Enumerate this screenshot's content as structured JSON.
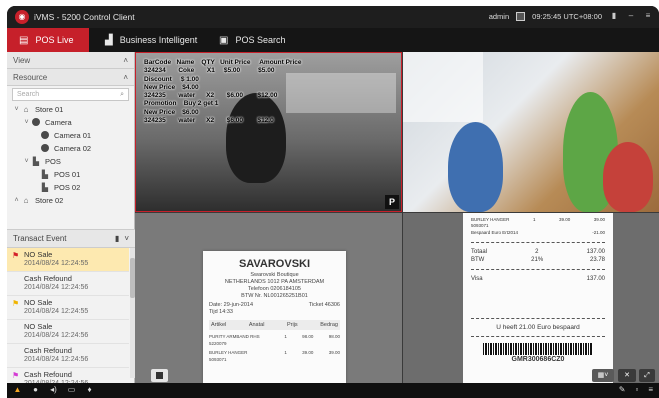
{
  "app": {
    "title": "iVMS - 5200 Control Client",
    "user": "admin",
    "clock": "09:25:45 UTC+08:00"
  },
  "nav": {
    "tabs": [
      {
        "label": "POS Live",
        "active": true
      },
      {
        "label": "Business Intelligent"
      },
      {
        "label": "POS Search"
      }
    ]
  },
  "sidebar": {
    "view_label": "View",
    "resource_label": "Resource",
    "search_placeholder": "Search",
    "tree": [
      {
        "label": "Store 01",
        "level": 0
      },
      {
        "label": "Camera",
        "level": 1
      },
      {
        "label": "Camera 01",
        "level": 2
      },
      {
        "label": "Camera 02",
        "level": 2
      },
      {
        "label": "POS",
        "level": 1
      },
      {
        "label": "POS 01",
        "level": 2
      },
      {
        "label": "POS 02",
        "level": 2
      },
      {
        "label": "Store 02",
        "level": 0
      }
    ]
  },
  "events": {
    "header": "Transact Event",
    "items": [
      {
        "name": "NO Sale",
        "time": "2014/08/24 12:24:55",
        "flag": "#d4202a",
        "selected": true
      },
      {
        "name": "Cash Refound",
        "time": "2014/08/24 12:24:56",
        "flag": ""
      },
      {
        "name": "NO Sale",
        "time": "2014/08/24 12:24:55",
        "flag": "#f0b400"
      },
      {
        "name": "NO Sale",
        "time": "2014/08/24 12:24:56",
        "flag": ""
      },
      {
        "name": "Cash Refound",
        "time": "2014/08/24 12:24:56",
        "flag": ""
      },
      {
        "name": "Cash Refound",
        "time": "2014/08/24 12:24:56",
        "flag": "#d43bd4"
      }
    ]
  },
  "overlay_text": "BarCode   Name    QTY   Unit Price     Amount Price\n324234       Coke       X1     $5.00          $5.00\nDiscount     $ 1.00\nNew Price    $4.00\n324235       water      X2       $6.00        $12.00\nPromotion    Buy 2 get 1\nNew Price    $6.00\n324235       water      X2       $6.00        $12.0",
  "pos_badge": "P",
  "receipt1": {
    "store": "SAVAROVSKI",
    "lines": [
      "Swarovski Boutique",
      "NETHERLANDS 1012 PA AMSTERDAM",
      "Telefoon 0206184105",
      "BTW Nr. NL001265251B01"
    ],
    "date": "Date: 29-jun-2014",
    "ticket": "Ticket 46306",
    "tijd": "Tijd 14:33",
    "cols": [
      "Artikel",
      "Anatal",
      "Prijs",
      "Bedrag"
    ],
    "items": [
      {
        "name": "PURITY ARMBAND RHS",
        "code": "5220079",
        "qty": "1",
        "price": "98.00",
        "amount": "98.00"
      },
      {
        "name": "BURLEY HANGER",
        "code": "5093071",
        "qty": "1",
        "price": "39.00",
        "amount": "39.00"
      }
    ]
  },
  "receipt2": {
    "item_name": "BURLEY HANGER",
    "item_code": "5093071",
    "item_qty": "1",
    "item_price": "39.00",
    "item_amount": "39.00",
    "discount_note": "Bespaard Euro Ert2014",
    "discount": "-21.00",
    "total_label": "Totaal",
    "total_qty": "2",
    "total": "137.00",
    "btw_label": "BTW",
    "btw_pct": "21%",
    "btw": "23.78",
    "visa_label": "Visa",
    "visa": "137.00",
    "saved": "U heeft 21.00 Euro bespaard",
    "barcode_text": "GMR300686CZ0"
  }
}
